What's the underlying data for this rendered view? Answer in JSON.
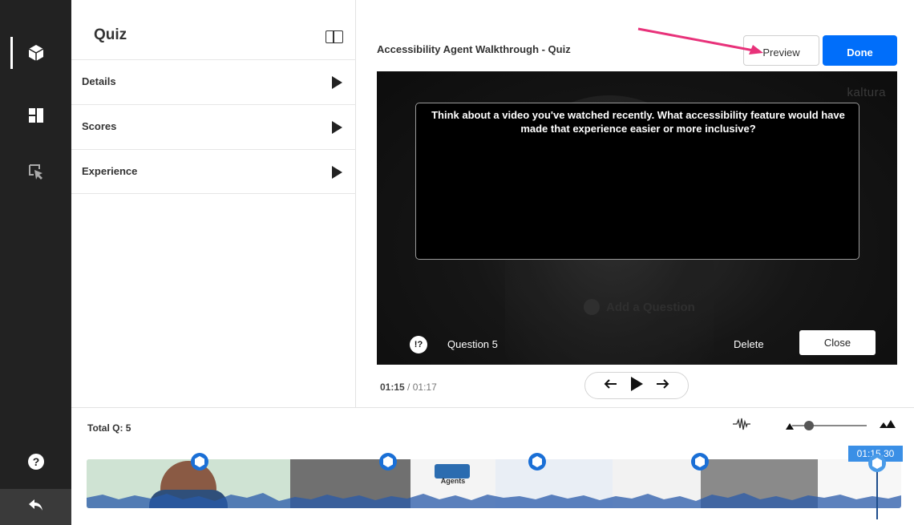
{
  "rail": {
    "icons": [
      "cube-icon",
      "chapters-icon",
      "cursor-icon",
      "help-icon",
      "back-icon"
    ]
  },
  "panel": {
    "title": "Quiz",
    "items": [
      {
        "label": "Details"
      },
      {
        "label": "Scores"
      },
      {
        "label": "Experience"
      }
    ]
  },
  "header": {
    "title": "Accessibility Agent Walkthrough - Quiz",
    "preview_label": "Preview",
    "done_label": "Done"
  },
  "player": {
    "watermark": "kaltura",
    "ghost_add": "Add a Question",
    "question_text": "Think about a video you've watched recently. What accessibility feature would have made that experience easier or more inclusive?",
    "question_icon": "!?",
    "question_label": "Question 5",
    "delete_label": "Delete",
    "close_label": "Close"
  },
  "playback": {
    "current": "01:15",
    "separator": " / ",
    "duration": "01:17"
  },
  "timeline": {
    "total_label": "Total Q: 5",
    "playhead_time": "01:15.30",
    "thumb_label": "Agents"
  },
  "colors": {
    "accent": "#006efa",
    "rail": "#222222",
    "annotation_arrow": "#e8327a",
    "marker": "#1a6fd6"
  }
}
